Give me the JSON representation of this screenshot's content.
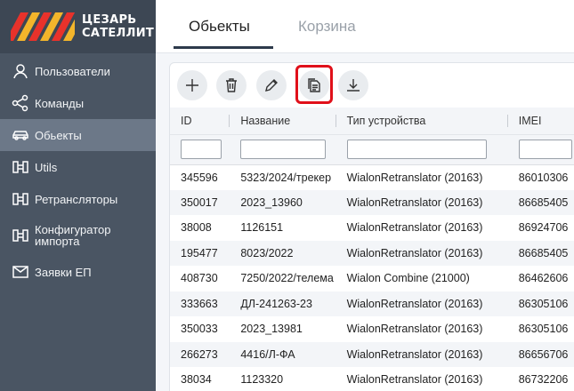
{
  "logo": {
    "line1": "ЦЕЗАРЬ",
    "line2": "САТЕЛЛИТ",
    "stripe_colors": [
      "#e8322b",
      "#f3b52b"
    ]
  },
  "sidebar": {
    "items": [
      {
        "label": "Пользователи",
        "icon": "user-icon"
      },
      {
        "label": "Команды",
        "icon": "share-icon"
      },
      {
        "label": "Обьекты",
        "icon": "car-icon",
        "active": true
      },
      {
        "label": "Utils",
        "icon": "router-icon"
      },
      {
        "label": "Ретрансляторы",
        "icon": "router-icon"
      },
      {
        "label": "Конфигуратор импорта",
        "icon": "router-icon"
      },
      {
        "label": "Заявки ЕП",
        "icon": "mail-icon"
      }
    ]
  },
  "tabs": {
    "objects": "Обьекты",
    "trash": "Корзина"
  },
  "toolbar": [
    "add-icon",
    "delete-icon",
    "edit-icon",
    "copy-icon",
    "download-icon"
  ],
  "table": {
    "headers": [
      "ID",
      "Название",
      "Тип устройства",
      "IMEI"
    ],
    "rows": [
      [
        "345596",
        "5323/2024/трекер",
        "WialonRetranslator (20163)",
        "86010306"
      ],
      [
        "350017",
        "2023_13960",
        "WialonRetranslator (20163)",
        "86685405"
      ],
      [
        "38008",
        "1126151",
        "WialonRetranslator (20163)",
        "86924706"
      ],
      [
        "195477",
        "8023/2022",
        "WialonRetranslator (20163)",
        "86685405"
      ],
      [
        "408730",
        "7250/2022/телема",
        "Wialon Combine (21000)",
        "86462606"
      ],
      [
        "333663",
        "ДЛ-241263-23",
        "WialonRetranslator (20163)",
        "86305106"
      ],
      [
        "350033",
        "2023_13981",
        "WialonRetranslator (20163)",
        "86305106"
      ],
      [
        "266273",
        "4416/Л-ФА",
        "WialonRetranslator (20163)",
        "86656706"
      ],
      [
        "38034",
        "1123320",
        "WialonRetranslator (20163)",
        "86732206"
      ]
    ]
  },
  "colors": {
    "sidebar": "#4a5563",
    "active_item": "#6c7888",
    "highlight": "#e0101a"
  }
}
